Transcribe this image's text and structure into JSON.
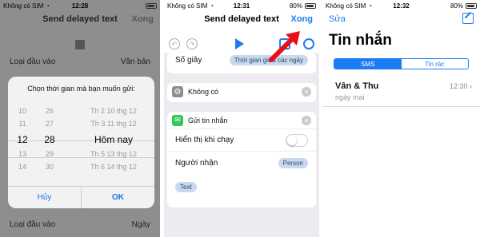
{
  "panel1": {
    "status": {
      "carrier": "Không có SIM",
      "time": "12:28"
    },
    "title": "Send delayed text",
    "done": "Xong",
    "row_top": {
      "label": "Loại đầu vào",
      "value": "Văn bản"
    },
    "dialog": {
      "message": "Chọn thời gian mà bạn muốn gửi:",
      "picker_rows": [
        {
          "hour": "10",
          "minute": "26",
          "day": "Th 2 10 thg 12"
        },
        {
          "hour": "11",
          "minute": "27",
          "day": "Th 3 11 thg 12"
        },
        {
          "hour": "12",
          "minute": "28",
          "day": "Hôm nay"
        },
        {
          "hour": "13",
          "minute": "29",
          "day": "Th 5 13 thg 12"
        },
        {
          "hour": "14",
          "minute": "30",
          "day": "Th 6 14 thg 12"
        }
      ],
      "cancel": "Hủy",
      "ok": "OK"
    },
    "row_bottom": {
      "label": "Loại đầu vào",
      "value": "Ngày"
    }
  },
  "panel2": {
    "status": {
      "carrier": "Không có SIM",
      "time": "12:31",
      "battery": "80%"
    },
    "title": "Send delayed text",
    "done": "Xong",
    "partial_row_label": "Số giây",
    "partial_row_pill": "Thời gian giữa các ngày",
    "card_none": "Không có",
    "card_send": "Gửi tin nhắn",
    "show_when_run": "Hiển thị khi chạy",
    "recipient_label": "Người nhận",
    "recipient_pill": "Person",
    "text_pill": "Text"
  },
  "panel3": {
    "status": {
      "carrier": "Không có SIM",
      "time": "12:32",
      "battery": "80%"
    },
    "edit": "Sửa",
    "title": "Tin nhắn",
    "seg_sms": "SMS",
    "seg_junk": "Tin rác",
    "conversation": {
      "name": "Vân & Thu",
      "time": "12:30",
      "preview": "ngày mai"
    }
  },
  "colors": {
    "accent": "#1a7cf5",
    "arrow": "#e8101b",
    "toggle_off": "#ffffff"
  }
}
